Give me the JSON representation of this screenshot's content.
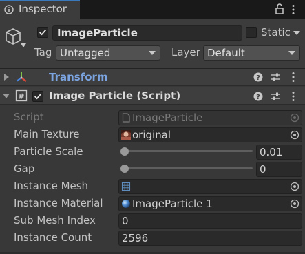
{
  "tab": {
    "label": "Inspector",
    "icon": "info-icon",
    "lock_icon": "lock-icon",
    "menu_icon": "kebab-menu-icon"
  },
  "gameobject": {
    "icon": "cube-icon",
    "active": true,
    "name": "ImageParticle",
    "static_label": "Static",
    "static": false,
    "tag_label": "Tag",
    "tag_value": "Untagged",
    "layer_label": "Layer",
    "layer_value": "Default"
  },
  "components": {
    "transform": {
      "title": "Transform",
      "icon": "transform-axes-icon",
      "expanded": false
    },
    "image_particle": {
      "title": "Image Particle (Script)",
      "icon": "csharp-script-icon",
      "enabled": true,
      "expanded": true
    }
  },
  "properties": {
    "script": {
      "label": "Script",
      "value": "ImageParticle"
    },
    "main_texture": {
      "label": "Main Texture",
      "value": "original"
    },
    "particle_scale": {
      "label": "Particle Scale",
      "value": "0.01",
      "slider_fraction": 0.0
    },
    "gap": {
      "label": "Gap",
      "value": "0",
      "slider_fraction": 0.0
    },
    "instance_mesh": {
      "label": "Instance Mesh",
      "value": ""
    },
    "instance_material": {
      "label": "Instance Material",
      "value": "ImageParticle 1"
    },
    "sub_mesh_index": {
      "label": "Sub Mesh Index",
      "value": "0"
    },
    "instance_count": {
      "label": "Instance Count",
      "value": "2596"
    }
  },
  "colors": {
    "accent_tab": "#3a79bb",
    "transform_title": "#7ba4e0",
    "background": "#383838"
  }
}
